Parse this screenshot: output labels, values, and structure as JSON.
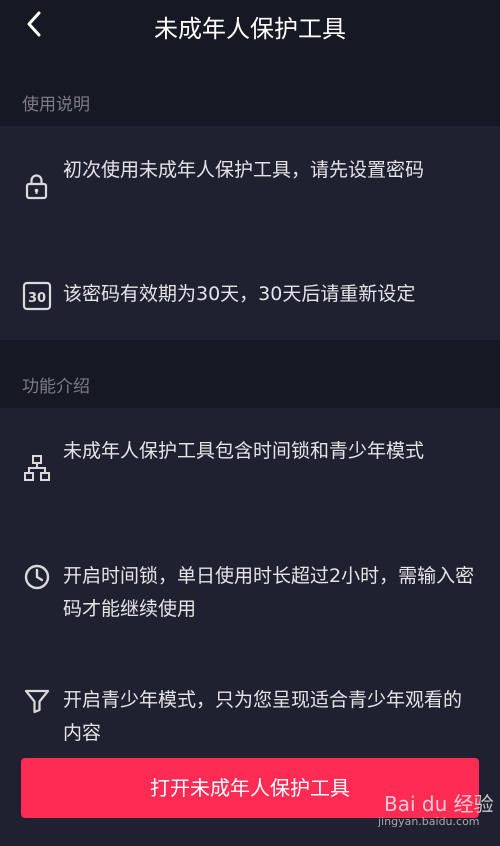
{
  "header": {
    "title": "未成年人保护工具",
    "back_icon": "chevron-left-icon"
  },
  "usage": {
    "label": "使用说明",
    "items": [
      {
        "icon": "lock-icon",
        "text": "初次使用未成年人保护工具，请先设置密码"
      },
      {
        "icon": "calendar-30-icon",
        "text": "该密码有效期为30天，30天后请重新设定"
      }
    ]
  },
  "features": {
    "label": "功能介绍",
    "items": [
      {
        "icon": "hierarchy-icon",
        "text": "未成年人保护工具包含时间锁和青少年模式"
      },
      {
        "icon": "clock-icon",
        "text": "开启时间锁，单日使用时长超过2小时，需输入密码才能继续使用"
      },
      {
        "icon": "filter-icon",
        "text": "开启青少年模式，只为您呈现适合青少年观看的内容"
      }
    ]
  },
  "cta": {
    "label": "打开未成年人保护工具"
  },
  "watermark": {
    "text": "Bai du 经验",
    "sub": "jingyan.baidu.com"
  },
  "colors": {
    "background": "#161823",
    "panel": "#1f2130",
    "accent": "#fe2c55"
  }
}
